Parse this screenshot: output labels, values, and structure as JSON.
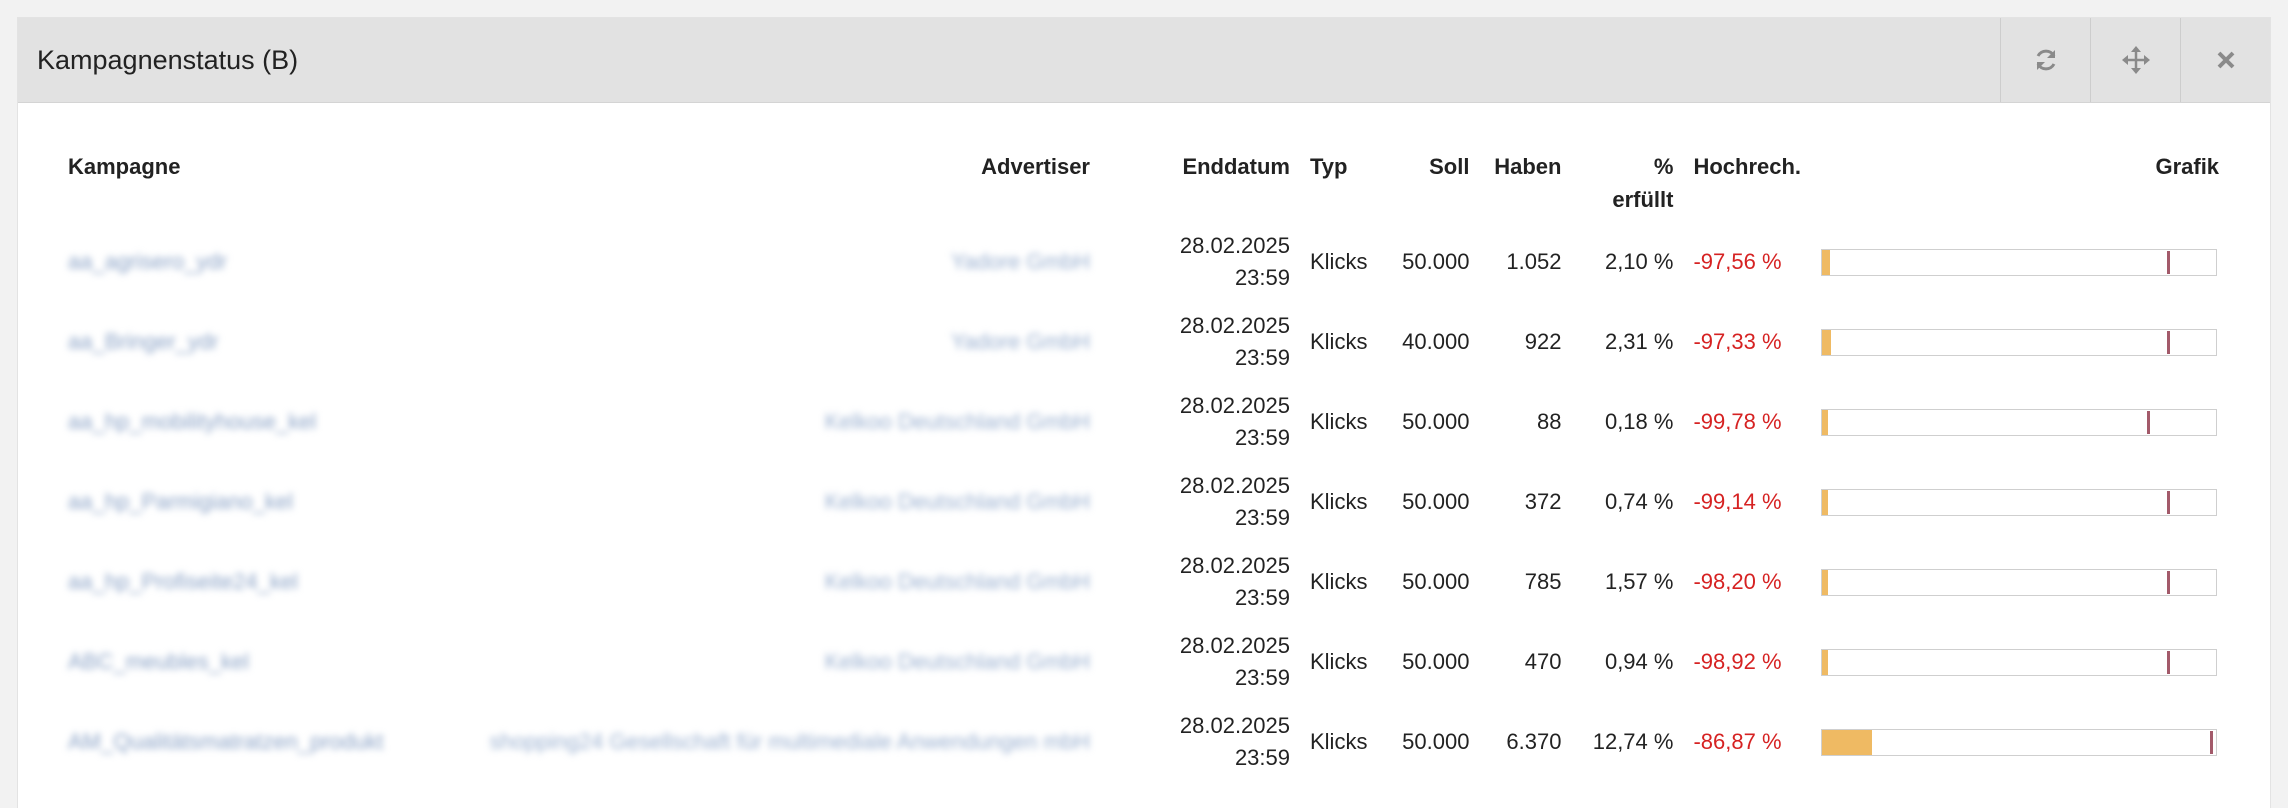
{
  "widget": {
    "title": "Kampagnenstatus (B)",
    "tools": [
      {
        "name": "refresh-icon"
      },
      {
        "name": "move-icon"
      },
      {
        "name": "close-icon"
      }
    ]
  },
  "table": {
    "headers": {
      "kampagne": "Kampagne",
      "advertiser": "Advertiser",
      "enddatum": "Enddatum",
      "typ": "Typ",
      "soll": "Soll",
      "haben": "Haben",
      "erfuellt_line1": "%",
      "erfuellt_line2": "erfüllt",
      "hochrech": "Hochrech.",
      "grafik": "Grafik"
    },
    "rows": [
      {
        "kampagne": "aa_agrisero_ydr",
        "advertiser": "Yadore GmbH",
        "date": "28.02.2025",
        "time": "23:59",
        "typ": "Klicks",
        "soll": "50.000",
        "haben": "1.052",
        "erfuellt": "2,10 %",
        "hochrech": "-97,56 %",
        "progress_pct": 2.1,
        "expected_pct": 87.5
      },
      {
        "kampagne": "aa_Bringer_ydr",
        "advertiser": "Yadore GmbH",
        "date": "28.02.2025",
        "time": "23:59",
        "typ": "Klicks",
        "soll": "40.000",
        "haben": "922",
        "erfuellt": "2,31 %",
        "hochrech": "-97,33 %",
        "progress_pct": 2.31,
        "expected_pct": 87.5
      },
      {
        "kampagne": "aa_hp_mobilityhouse_kel",
        "advertiser": "Kelkoo Deutschland GmbH",
        "date": "28.02.2025",
        "time": "23:59",
        "typ": "Klicks",
        "soll": "50.000",
        "haben": "88",
        "erfuellt": "0,18 %",
        "hochrech": "-99,78 %",
        "progress_pct": 0.18,
        "expected_pct": 82.5
      },
      {
        "kampagne": "aa_hp_Parmigiano_kel",
        "advertiser": "Kelkoo Deutschland GmbH",
        "date": "28.02.2025",
        "time": "23:59",
        "typ": "Klicks",
        "soll": "50.000",
        "haben": "372",
        "erfuellt": "0,74 %",
        "hochrech": "-99,14 %",
        "progress_pct": 0.74,
        "expected_pct": 87.5
      },
      {
        "kampagne": "aa_hp_Profiseite24_kel",
        "advertiser": "Kelkoo Deutschland GmbH",
        "date": "28.02.2025",
        "time": "23:59",
        "typ": "Klicks",
        "soll": "50.000",
        "haben": "785",
        "erfuellt": "1,57 %",
        "hochrech": "-98,20 %",
        "progress_pct": 1.57,
        "expected_pct": 87.5
      },
      {
        "kampagne": "ABC_meubles_kel",
        "advertiser": "Kelkoo Deutschland GmbH",
        "date": "28.02.2025",
        "time": "23:59",
        "typ": "Klicks",
        "soll": "50.000",
        "haben": "470",
        "erfuellt": "0,94 %",
        "hochrech": "-98,92 %",
        "progress_pct": 0.94,
        "expected_pct": 87.5
      },
      {
        "kampagne": "AM_Qualitätsmatratzen_produkt",
        "advertiser": "shopping24 Gesellschaft für multimediale Anwendungen mbH",
        "date": "28.02.2025",
        "time": "23:59",
        "typ": "Klicks",
        "soll": "50.000",
        "haben": "6.370",
        "erfuellt": "12,74 %",
        "hochrech": "-86,87 %",
        "progress_pct": 12.74,
        "expected_pct": 98.5
      }
    ]
  },
  "colors": {
    "header_bg": "#e2e2e2",
    "link_blurred": "#8aa2c6",
    "negative": "#d62222",
    "bar_fill": "#efba63",
    "bar_marker": "#a35a6a"
  }
}
